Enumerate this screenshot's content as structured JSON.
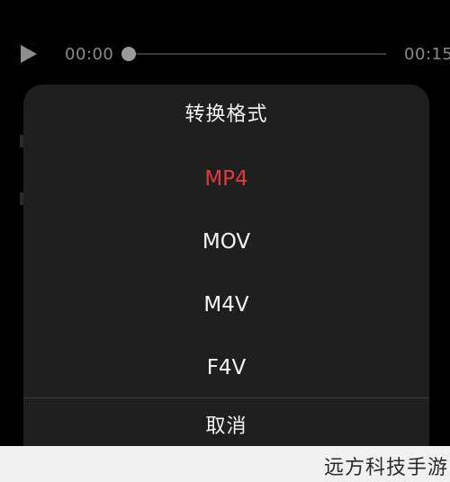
{
  "player": {
    "play_icon": "play-icon",
    "current_time": "00:00",
    "total_time": "00:15",
    "progress": 0.0
  },
  "sheet": {
    "title": "转换格式",
    "options": [
      {
        "label": "MP4",
        "selected": true
      },
      {
        "label": "MOV",
        "selected": false
      },
      {
        "label": "M4V",
        "selected": false
      },
      {
        "label": "F4V",
        "selected": false
      }
    ],
    "cancel_label": "取消"
  },
  "colors": {
    "background": "#000000",
    "sheet_background": "#1f1f1f",
    "selected": "#e03a40",
    "text": "#f4f4f4",
    "muted": "#8b8b8b"
  },
  "watermark": {
    "text": "远方科技手游"
  }
}
